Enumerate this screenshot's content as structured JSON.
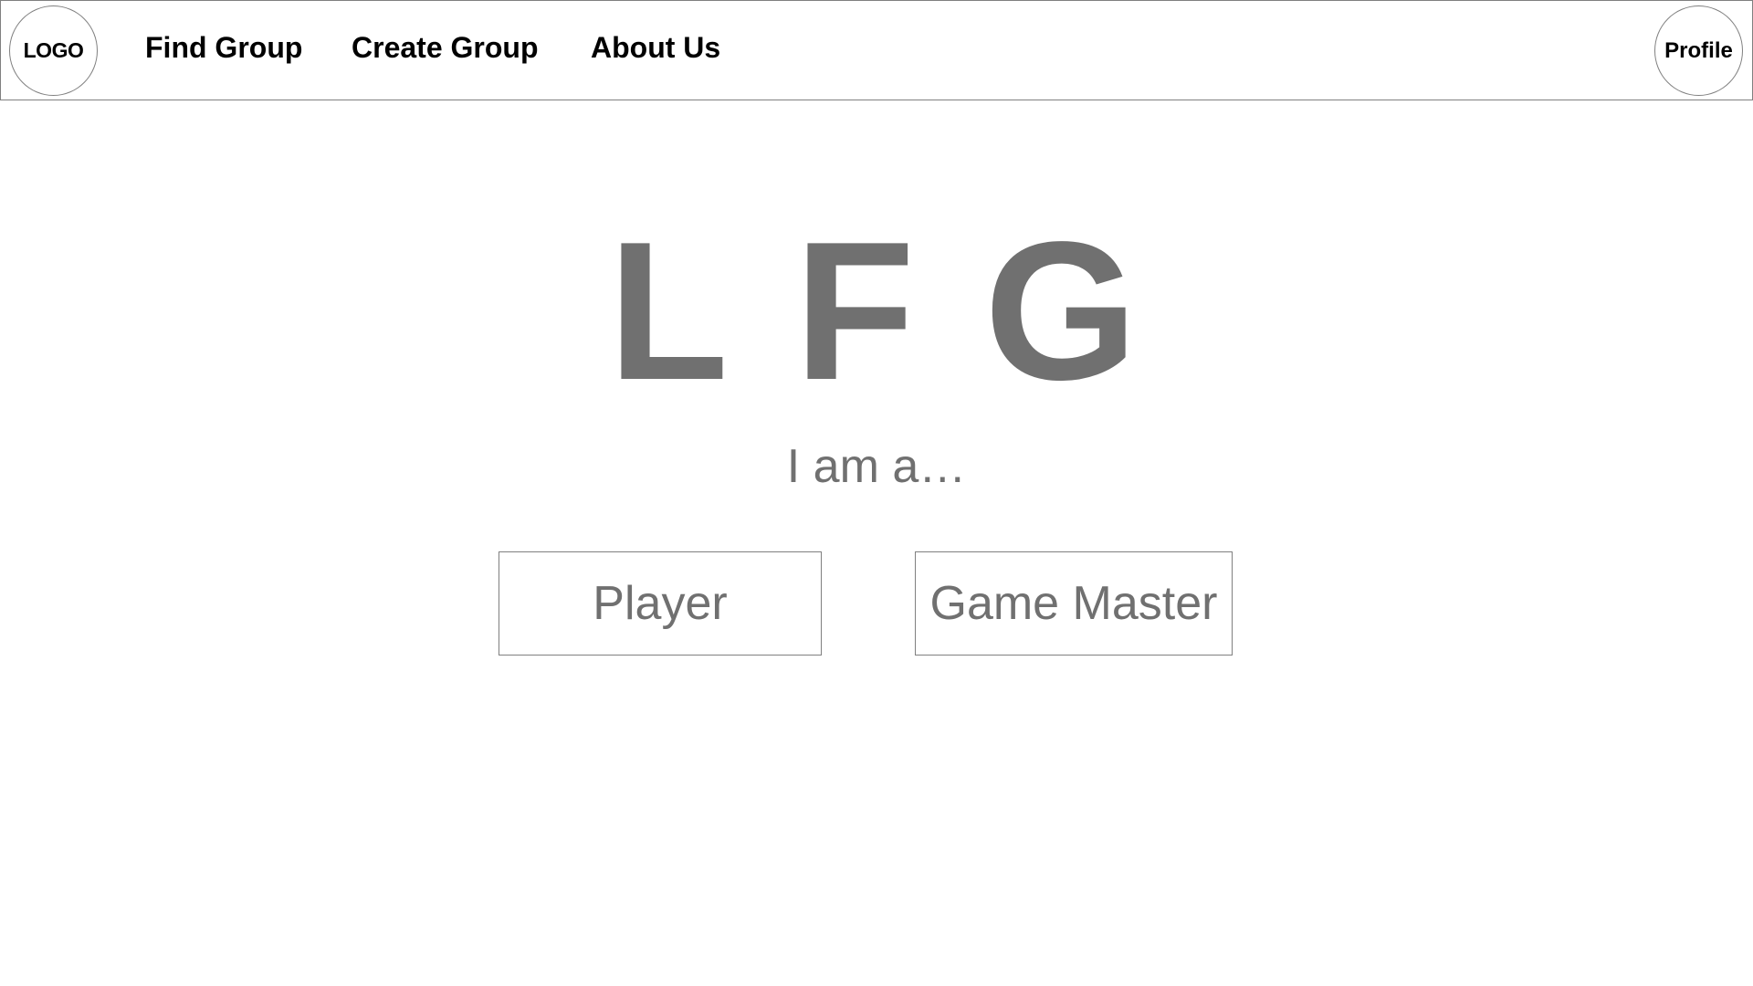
{
  "nav": {
    "logo_label": "LOGO",
    "links": [
      {
        "label": "Find Group"
      },
      {
        "label": "Create Group"
      },
      {
        "label": "About Us"
      }
    ],
    "profile_label": "Profile"
  },
  "hero": {
    "title": "L F G",
    "subtitle": "I am a…"
  },
  "roles": [
    {
      "label": "Player"
    },
    {
      "label": "Game Master"
    }
  ],
  "colors": {
    "text_primary": "#000000",
    "text_muted": "#707070",
    "border": "#808080",
    "background": "#ffffff"
  }
}
